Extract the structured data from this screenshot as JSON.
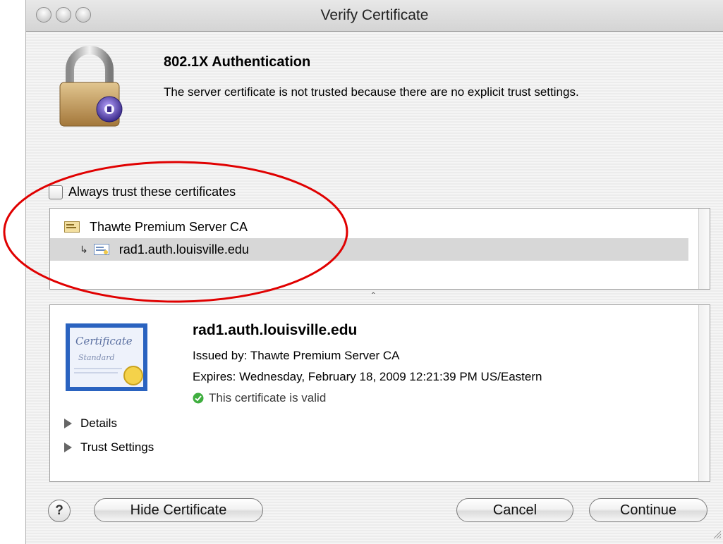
{
  "window": {
    "title": "Verify Certificate"
  },
  "alert": {
    "heading": "802.1X Authentication",
    "message": "The server certificate is not trusted because there are no explicit trust settings.",
    "icon": "padlock-icon"
  },
  "trust_checkbox": {
    "label": "Always trust these certificates",
    "checked": false
  },
  "cert_tree": {
    "items": [
      {
        "label": "Thawte Premium Server CA",
        "icon": "certificate-icon",
        "selected": false
      },
      {
        "label": "rad1.auth.louisville.edu",
        "icon": "certificate-icon",
        "selected": true,
        "child": true
      }
    ],
    "child_arrow": "↳"
  },
  "splitter": {
    "glyph": "ˆ"
  },
  "details": {
    "name": "rad1.auth.louisville.edu",
    "issued_by": "Issued by: Thawte Premium Server CA",
    "expires": "Expires: Wednesday, February 18, 2009 12:21:39 PM US/Eastern",
    "status": "This certificate is valid",
    "status_color": "#3fae3f",
    "sections": [
      "Details",
      "Trust Settings"
    ],
    "cert_image_text": [
      "Certificate",
      "Standard"
    ]
  },
  "buttons": {
    "help": "?",
    "hide_certificate": "Hide Certificate",
    "cancel": "Cancel",
    "continue": "Continue"
  },
  "annotation": {
    "color": "#e00000"
  }
}
